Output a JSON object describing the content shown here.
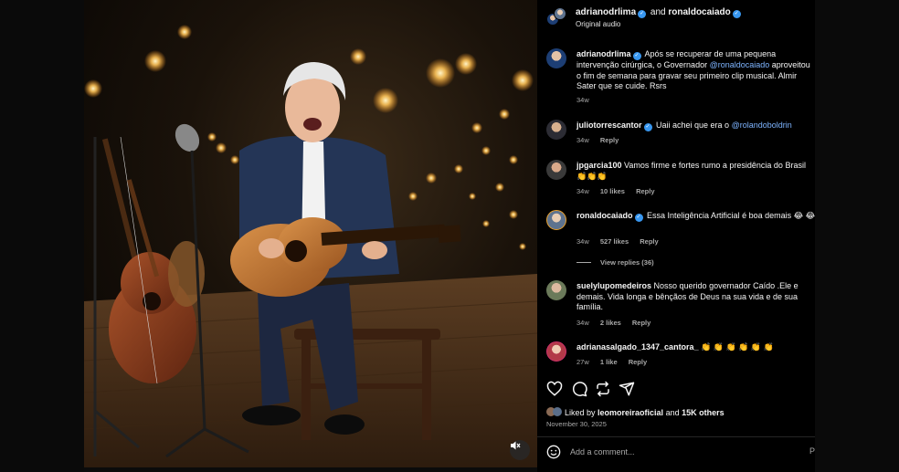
{
  "header": {
    "user1": "adrianodrlima",
    "and_text": "and",
    "user2": "ronaldocaiado",
    "audio": "Original audio"
  },
  "caption": {
    "user": "adrianodrlima",
    "text_before": " Após se recuperar de uma pequena intervenção cirúrgica, o Governador ",
    "mention": "@ronaldocaiado",
    "text_after": " aproveitou o fim de semana para gravar seu primeiro clip musical. Almir Sater que se cuide. Rsrs",
    "time": "34w"
  },
  "comments": [
    {
      "user": "juliotorrescantor",
      "text": " Uaii achei que era o ",
      "mention": "@rolandoboldrin",
      "time": "34w",
      "reply": "Reply"
    },
    {
      "user": "jpgarcia100",
      "text": " Vamos firme e fortes rumo a presidência do Brasil",
      "emojis": "👏👏👏",
      "time": "34w",
      "likes": "10 likes",
      "reply": "Reply"
    },
    {
      "user": "ronaldocaiado",
      "text": " Essa Inteligência Artificial é boa demais ",
      "emojis": "😂 😂",
      "time": "34w",
      "likes": "527 likes",
      "reply": "Reply",
      "view_replies": "View replies (36)"
    },
    {
      "user": "suelylupomedeiros",
      "text": " Nosso querido governador Caído .Ele e demais. Vida longa e bênçãos de Deus na sua vida e de sua família.",
      "time": "34w",
      "likes": "2 likes",
      "reply": "Reply"
    },
    {
      "user": "adrianasalgado_1347_cantora_",
      "emojis": " 👏 👏 👏 👏 👏 👏",
      "time": "27w",
      "likes": "1 like",
      "reply": "Reply"
    }
  ],
  "likes": {
    "prefix": "Liked by ",
    "user": "leomoreiraoficial",
    "middle": " and ",
    "others": "15K others"
  },
  "date": "November 30, 2025",
  "comment_box": {
    "placeholder": "Add a comment...",
    "post": "P"
  },
  "icons": {
    "like": "heart-icon",
    "comment": "comment-bubble-icon",
    "share": "repost-icon",
    "send": "paper-plane-icon",
    "emoji": "smiley-icon",
    "mute": "speaker-muted-icon"
  },
  "colors": {
    "background": "#000000",
    "mention": "#7eb4ff",
    "verified": "#3897f0",
    "meta": "#a8a8a8"
  }
}
